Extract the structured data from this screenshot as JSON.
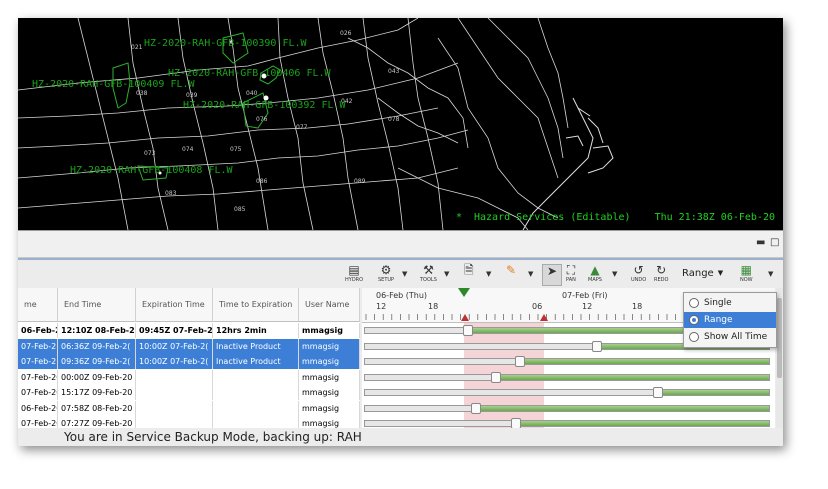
{
  "map": {
    "hazard_labels": [
      "HZ-2020-RAH-GFB-100390 FL.W",
      "HZ-2020-RAH-GFB-100406 FL.W",
      "HZ-2020-RAH-GFB-100409 FL.W",
      "HZ-2020-RAH-GFB-100392 FL.W",
      "HZ-2020-RAH-GFB-100408 FL.W"
    ],
    "county_codes": [
      "021",
      "026",
      "043",
      "039",
      "040",
      "042",
      "038",
      "076",
      "077",
      "078",
      "073",
      "074",
      "075",
      "083",
      "085",
      "086",
      "089"
    ],
    "status_text": "Hazard Services (Editable)",
    "status_time": "Thu 21:38Z 06-Feb-20"
  },
  "toolbar": {
    "hydro": "HYDRO",
    "setup": "SETUP",
    "tools": "TOOLS",
    "pan": "PAN",
    "maps": "MAPS",
    "undo": "UNDO",
    "redo": "REDO",
    "now": "NOW",
    "range_label": "Range"
  },
  "range_menu": {
    "options": [
      "Single",
      "Range",
      "Show All Time"
    ],
    "selected": "Range"
  },
  "table": {
    "headers": [
      "me",
      "End Time",
      "Expiration Time",
      "Time to Expiration",
      "User Name"
    ],
    "rows": [
      {
        "c0": "06-Feb-2(",
        "c1": "12:10Z 08-Feb-2(",
        "c2": "09:45Z 07-Feb-2(",
        "c3": "12hrs 2min",
        "c4": "mmagsig",
        "selected": false,
        "bold": true
      },
      {
        "c0": "07-Feb-2(",
        "c1": "06:36Z 09-Feb-2(",
        "c2": "10:00Z 07-Feb-2(",
        "c3": "Inactive Product",
        "c4": "mmagsig",
        "selected": true,
        "bold": false
      },
      {
        "c0": "07-Feb-2(",
        "c1": "09:36Z 09-Feb-2(",
        "c2": "10:00Z 07-Feb-2(",
        "c3": "Inactive Product",
        "c4": "mmagsig",
        "selected": true,
        "bold": false
      },
      {
        "c0": "07-Feb-20",
        "c1": "00:00Z 09-Feb-20",
        "c2": "",
        "c3": "",
        "c4": "mmagsig",
        "selected": false,
        "bold": false
      },
      {
        "c0": "07-Feb-20",
        "c1": "15:17Z 09-Feb-20",
        "c2": "",
        "c3": "",
        "c4": "mmagsig",
        "selected": false,
        "bold": false
      },
      {
        "c0": "06-Feb-20",
        "c1": "07:58Z 08-Feb-20",
        "c2": "",
        "c3": "",
        "c4": "mmagsig",
        "selected": false,
        "bold": false
      },
      {
        "c0": "07-Feb-20",
        "c1": "07:27Z 09-Feb-20",
        "c2": "",
        "c3": "",
        "c4": "mmagsig",
        "selected": false,
        "bold": false
      }
    ]
  },
  "timeline": {
    "day_labels": [
      "06-Feb (Thu)",
      "07-Feb (Fri)"
    ],
    "hour_labels": [
      "12",
      "18",
      "06",
      "12",
      "18"
    ],
    "bars": [
      {
        "start": 0.25,
        "fill_from": 0.25
      },
      {
        "start": 0.57,
        "fill_from": 0.57
      },
      {
        "start": 0.38,
        "fill_from": 0.38
      },
      {
        "start": 0.32,
        "fill_from": 0.32
      },
      {
        "start": 0.72,
        "fill_from": 0.72
      },
      {
        "start": 0.27,
        "fill_from": 0.27
      },
      {
        "start": 0.37,
        "fill_from": 0.37
      }
    ]
  },
  "footer": {
    "message": "You are in Service Backup Mode, backing up: RAH"
  }
}
